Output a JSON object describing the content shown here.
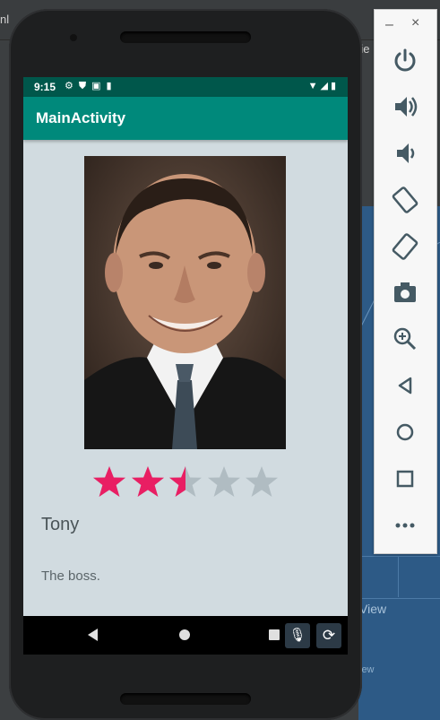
{
  "ide": {
    "left_tab_text": "nl",
    "right_partial_text": "rie",
    "view_label_1": "View",
    "view_label_2": "iew"
  },
  "device": {
    "status_time": "9:15",
    "status_icons": [
      "settings-icon",
      "shield-icon",
      "font-icon",
      "sdcard-icon"
    ],
    "status_right_icons": [
      "wifi-icon",
      "signal-icon",
      "battery-icon"
    ]
  },
  "app": {
    "title": "MainActivity",
    "rating": {
      "value": 2.5,
      "max": 5,
      "filled_color": "#e91e63",
      "empty_color": "#b0bcc2"
    },
    "name": "Tony",
    "description": "The boss."
  },
  "emulator_toolbar": {
    "window_minimize": "–",
    "window_close": "×",
    "buttons": [
      "power-icon",
      "volume-up-icon",
      "volume-down-icon",
      "rotate-left-icon",
      "rotate-right-icon",
      "screenshot-icon",
      "zoom-icon",
      "back-icon",
      "home-icon",
      "overview-icon",
      "more-icon"
    ]
  },
  "colors": {
    "accent": "#00897b",
    "status_bar": "#00574b",
    "screen_bg": "#d1dbe0"
  }
}
